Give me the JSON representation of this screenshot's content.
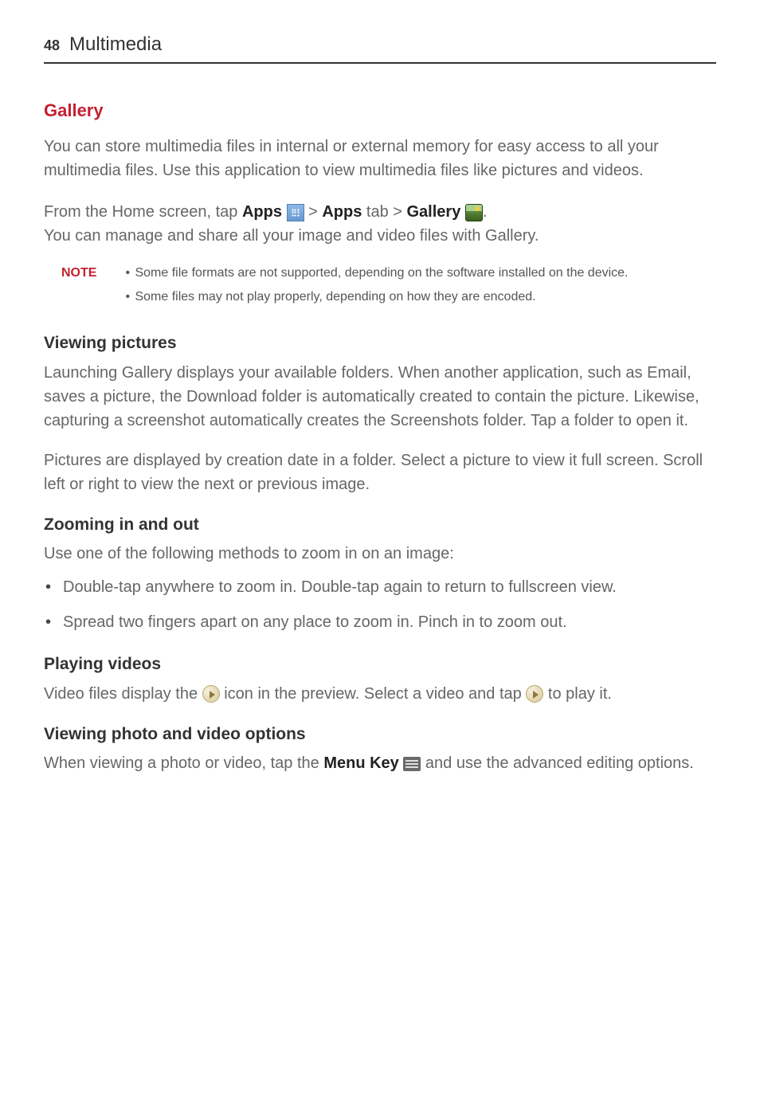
{
  "header": {
    "page_number": "48",
    "chapter": "Multimedia"
  },
  "gallery": {
    "title": "Gallery",
    "intro": "You can store multimedia files in internal or external memory for easy access to all your multimedia files. Use this application to view multimedia files like pictures and videos.",
    "instruction_pre": "From the Home screen, tap ",
    "apps_bold": "Apps",
    "gt1": " > ",
    "apps_tab_bold": "Apps",
    "tab_text": " tab > ",
    "gallery_bold": "Gallery",
    "period": ".",
    "instruction_post": "You can manage and share all your image and video files with Gallery."
  },
  "note": {
    "label": "NOTE",
    "items": [
      "Some file formats are not supported, depending on the software installed on the device.",
      "Some files may not play properly, depending on how they are encoded."
    ]
  },
  "viewing_pictures": {
    "title": "Viewing pictures",
    "para1": "Launching Gallery displays your available folders. When another application, such as Email, saves a picture, the Download folder is automatically created to contain the picture. Likewise, capturing a screenshot automatically creates the Screenshots folder. Tap a folder to open it.",
    "para2": "Pictures are displayed by creation date in a folder. Select a picture to view it full screen. Scroll left or right to view the next or previous image."
  },
  "zooming": {
    "title": "Zooming in and out",
    "intro": "Use one of the following methods to zoom in on an image:",
    "items": [
      "Double-tap anywhere to zoom in. Double-tap again to return to fullscreen view.",
      "Spread two fingers apart on any place to zoom in. Pinch in to zoom out."
    ]
  },
  "playing_videos": {
    "title": "Playing videos",
    "text_pre": "Video files display the ",
    "text_mid": " icon in the preview. Select a video and tap ",
    "text_post": " to play it."
  },
  "viewing_options": {
    "title": "Viewing photo and video options",
    "text_pre": "When viewing a photo or video, tap the ",
    "menu_bold": "Menu Key",
    "text_post": " and use the advanced editing options."
  }
}
